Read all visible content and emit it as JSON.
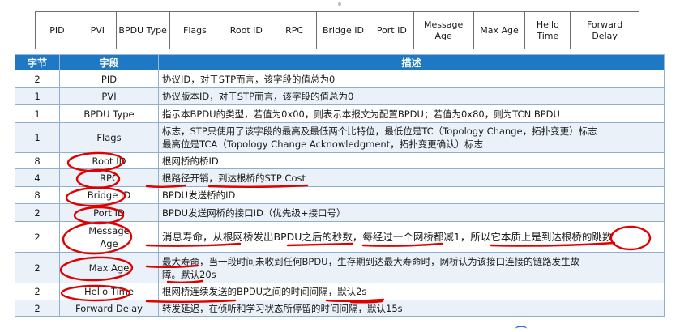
{
  "frame_fields": [
    "PID",
    "PVI",
    "BPDU Type",
    "Flags",
    "Root ID",
    "RPC",
    "Bridge ID",
    "Port ID",
    "Message\nAge",
    "Max Age",
    "Hello\nTime",
    "Forward\nDelay"
  ],
  "table": {
    "headers": [
      "字节",
      "字段",
      "描述"
    ],
    "rows": [
      {
        "bytes": "2",
        "field": "PID",
        "desc": "协议ID，对于STP而言，该字段的值总为0"
      },
      {
        "bytes": "1",
        "field": "PVI",
        "desc": "协议版本ID，对于STP而言，该字段的值总为0"
      },
      {
        "bytes": "1",
        "field": "BPDU Type",
        "desc": "指示本BPDU的类型，若值为0x00，则表示本报文为配置BPDU；若值为0x80，则为TCN BPDU"
      },
      {
        "bytes": "1",
        "field": "Flags",
        "desc": "标志，STP只使用了该字段的最高及最低两个比特位，最低位是TC（Topology Change，拓扑变更）标志\n最高位是TCA（Topology Change Acknowledgment，拓扑变更确认）标志"
      },
      {
        "bytes": "8",
        "field": "Root ID",
        "desc": "根网桥的桥ID"
      },
      {
        "bytes": "4",
        "field": "RPC",
        "desc": "根路径开销，到达根桥的STP Cost"
      },
      {
        "bytes": "8",
        "field": "Bridge ID",
        "desc": "BPDU发送桥的ID"
      },
      {
        "bytes": "2",
        "field": "Port ID",
        "desc": "BPDU发送网桥的接口ID（优先级+接口号）"
      },
      {
        "bytes": "2",
        "field": "Message\nAge",
        "desc": "消息寿命，从根网桥发出BPDU之后的秒数，每经过一个网桥都减1，所以它本质上是到达根桥的跳数"
      },
      {
        "bytes": "2",
        "field": "Max Age",
        "desc": "最大寿命，当一段时间未收到任何BPDU，生存期到达最大寿命时，网桥认为该接口连接的链路发生故\n障。默认20s"
      },
      {
        "bytes": "2",
        "field": "Hello Time",
        "desc": "根网桥连续发送的BPDU之间的时间间隔，默认2s"
      },
      {
        "bytes": "2",
        "field": "Forward Delay",
        "desc": "转发延迟，在侦听和学习状态所停留的时间间隔，默认15s"
      }
    ]
  },
  "colors": {
    "header_bg": "#1f78c4",
    "annotation": "#e00000",
    "row_alt": "#eaf1f8"
  }
}
